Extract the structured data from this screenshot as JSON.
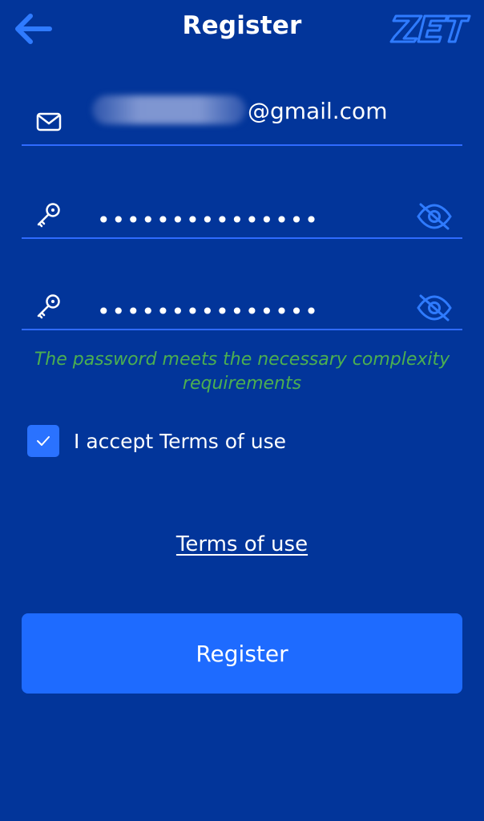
{
  "header": {
    "title": "Register",
    "logo_text": "ZET"
  },
  "email": {
    "value_visible_suffix": "@gmail.com"
  },
  "password": {
    "masked": "•••••••••••••••"
  },
  "confirm_password": {
    "masked": "•••••••••••••••"
  },
  "hint": {
    "text": "The password meets the necessary complexity requirements"
  },
  "terms": {
    "checkbox_checked": true,
    "accept_label": "I accept Terms of use",
    "link_label": "Terms of use"
  },
  "actions": {
    "register_label": "Register"
  },
  "colors": {
    "background": "#02359a",
    "accent": "#2f6bff",
    "button": "#1e6bff",
    "success": "#4caf50"
  }
}
